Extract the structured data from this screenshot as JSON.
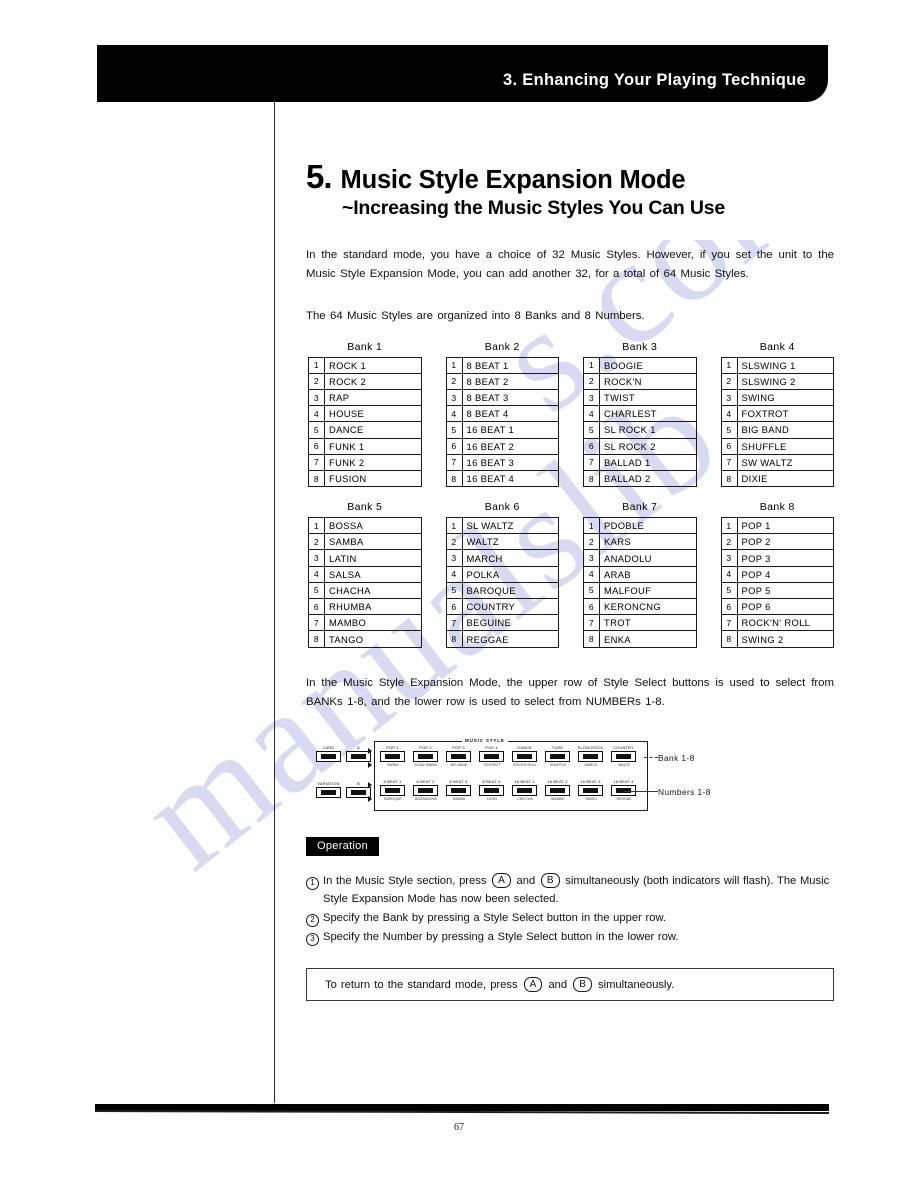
{
  "header": {
    "chapter_title": "3. Enhancing Your Playing Technique"
  },
  "section": {
    "number": "5.",
    "title": "Music Style Expansion Mode",
    "subtitle": "~Increasing the Music Styles You Can Use",
    "intro_paragraph": "In the standard mode, you have a choice of 32 Music Styles. However, if you set the unit to the Music Style Expansion Mode, you can add another 32, for a total of 64 Music Styles.",
    "organize_paragraph": "The 64 Music Styles are organized into 8 Banks and 8 Numbers.",
    "rows_paragraph": "In the Music Style Expansion Mode, the upper row of Style Select buttons is used to select from BANKs 1-8, and the lower row is used to select from NUMBERs 1-8."
  },
  "banks": [
    {
      "caption": "Bank 1",
      "numbers": [
        "1",
        "2",
        "3",
        "4",
        "5",
        "6",
        "7",
        "8"
      ],
      "styles": [
        "ROCK 1",
        "ROCK 2",
        "RAP",
        "HOUSE",
        "DANCE",
        "FUNK 1",
        "FUNK 2",
        "FUSION"
      ]
    },
    {
      "caption": "Bank 2",
      "numbers": [
        "1",
        "2",
        "3",
        "4",
        "5",
        "6",
        "7",
        "8"
      ],
      "styles": [
        "8 BEAT 1",
        "8 BEAT 2",
        "8 BEAT 3",
        "8 BEAT 4",
        "16 BEAT 1",
        "16 BEAT 2",
        "16 BEAT 3",
        "16 BEAT 4"
      ]
    },
    {
      "caption": "Bank 3",
      "numbers": [
        "1",
        "2",
        "3",
        "4",
        "5",
        "6",
        "7",
        "8"
      ],
      "styles": [
        "BOOGIE",
        "ROCK'N",
        "TWIST",
        "CHARLEST",
        "SL  ROCK 1",
        "SL  ROCK 2",
        "BALLAD 1",
        "BALLAD 2"
      ]
    },
    {
      "caption": "Bank 4",
      "numbers": [
        "1",
        "2",
        "3",
        "4",
        "5",
        "6",
        "7",
        "8"
      ],
      "styles": [
        "SLSWING 1",
        "SLSWING 2",
        "SWING",
        "FOXTROT",
        "BIG  BAND",
        "SHUFFLE",
        "SW WALTZ",
        "DIXIE"
      ]
    },
    {
      "caption": "Bank 5",
      "numbers": [
        "1",
        "2",
        "3",
        "4",
        "5",
        "6",
        "7",
        "8"
      ],
      "styles": [
        "BOSSA",
        "SAMBA",
        "LATIN",
        "SALSA",
        "CHACHA",
        "RHUMBA",
        "MAMBO",
        "TANGO"
      ]
    },
    {
      "caption": "Bank 6",
      "numbers": [
        "1",
        "2",
        "3",
        "4",
        "5",
        "6",
        "7",
        "8"
      ],
      "styles": [
        "SL WALTZ",
        "WALTZ",
        "MARCH",
        "POLKA",
        "BAROQUE",
        "COUNTRY",
        "BEGUINE",
        "REGGAE"
      ]
    },
    {
      "caption": "Bank 7",
      "numbers": [
        "1",
        "2",
        "3",
        "4",
        "5",
        "6",
        "7",
        "8"
      ],
      "styles": [
        "PDOBLE",
        "KARS",
        "ANADOLU",
        "ARAB",
        "MALFOUF",
        "KERONCNG",
        "TROT",
        "ENKA"
      ]
    },
    {
      "caption": "Bank 8",
      "numbers": [
        "1",
        "2",
        "3",
        "4",
        "5",
        "6",
        "7",
        "8"
      ],
      "styles": [
        "POP 1",
        "POP 2",
        "POP 3",
        "POP 4",
        "POP 5",
        "POP 6",
        "ROCK'N' ROLL",
        "SWING 2"
      ]
    }
  ],
  "panel": {
    "music_style_label": "MUSIC STYLE",
    "left_buttons": [
      {
        "label": "CARD"
      },
      {
        "label": "A"
      },
      {
        "label": "VARIATION"
      },
      {
        "label": "B"
      }
    ],
    "upper_row": [
      {
        "label": "POP 1",
        "sub": "SWING"
      },
      {
        "label": "POP 2",
        "sub": "SLOW SWING"
      },
      {
        "label": "POP 3",
        "sub": "BIG BAND"
      },
      {
        "label": "POP 4",
        "sub": "FOXTROT"
      },
      {
        "label": "DANCE",
        "sub": "ROCK'N ROLL"
      },
      {
        "label": "TURK",
        "sub": "SHUFFLE"
      },
      {
        "label": "SLOW ROCK",
        "sub": "MARCH"
      },
      {
        "label": "COUNTRY",
        "sub": "WALTZ"
      }
    ],
    "lower_row": [
      {
        "label": "8 BEAT 1",
        "sub": "BAROQUE"
      },
      {
        "label": "8 BEAT 2",
        "sub": "BOSSANOVA"
      },
      {
        "label": "8 BEAT 3",
        "sub": "SAMBA"
      },
      {
        "label": "8 BEAT 4",
        "sub": "LATIN"
      },
      {
        "label": "16 BEAT 1",
        "sub": "CHA CHA"
      },
      {
        "label": "16 BEAT 2",
        "sub": "MAMBO"
      },
      {
        "label": "16 BEAT 3",
        "sub": "TANGO"
      },
      {
        "label": "16 BEAT 4",
        "sub": "REGGAE"
      }
    ],
    "annotation_bank": "Bank 1-8",
    "annotation_numbers": "Numbers 1-8"
  },
  "operation": {
    "badge": "Operation",
    "steps": [
      {
        "num": "1",
        "parts": [
          "In the Music Style section, press ",
          "A",
          " and ",
          "B",
          " simultaneously (both indicators will flash). The Music Style Expansion Mode has now been selected."
        ]
      },
      {
        "num": "2",
        "text": "Specify the Bank by pressing a Style Select button in the upper row."
      },
      {
        "num": "3",
        "text": "Specify the Number by pressing a Style Select button in the lower row."
      }
    ]
  },
  "note": {
    "prefix": "To return to the standard mode, press ",
    "key_a": "A",
    "middle": " and ",
    "key_b": "B",
    "suffix": " simultaneously."
  },
  "footer": {
    "page_number": "67"
  },
  "watermark": {
    "text_1": "manualslib",
    "text_2": "s.com"
  },
  "colors": {
    "header_bg": "#000000",
    "header_text": "#ffffff",
    "watermark": "#b9c1e8",
    "rule": "#2b2b2b"
  }
}
